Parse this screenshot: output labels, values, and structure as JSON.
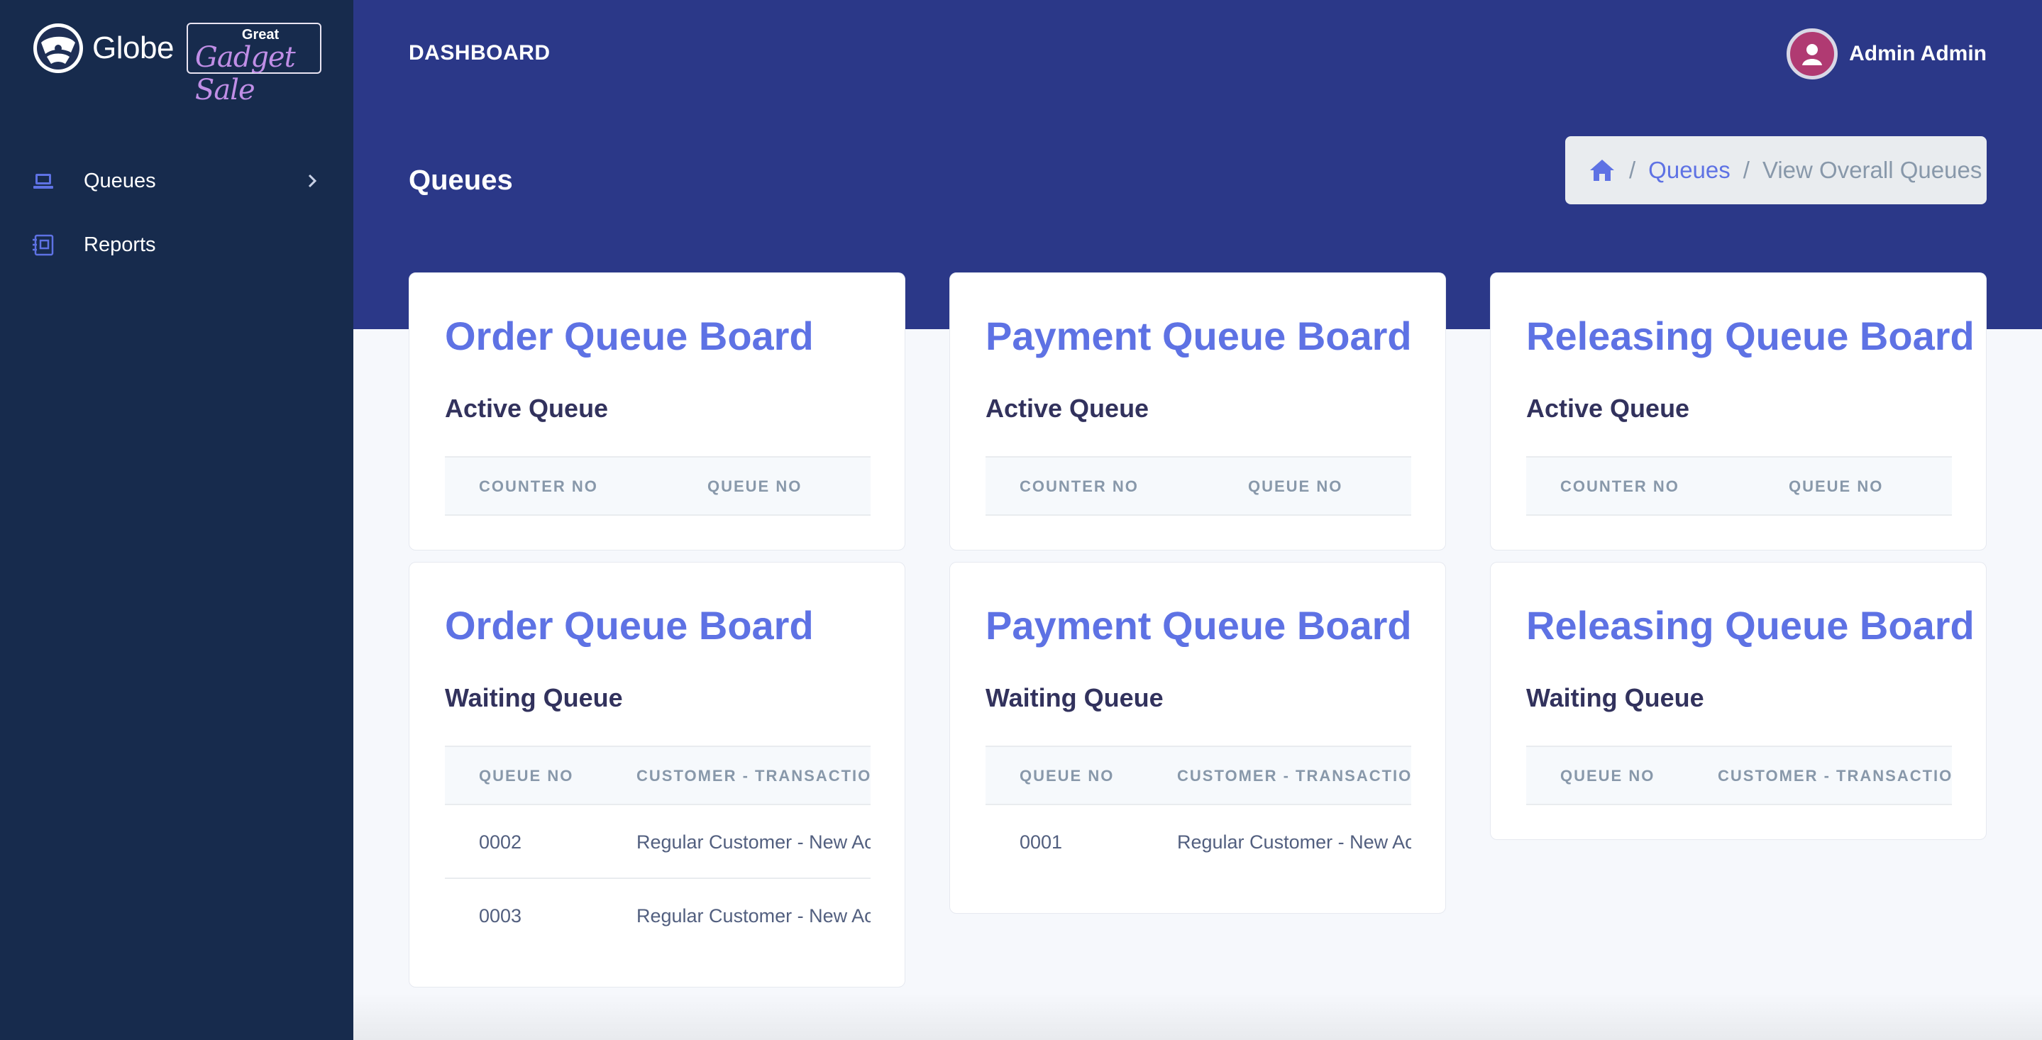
{
  "brand": {
    "name": "Globe",
    "sale_top": "Great",
    "sale_script": "Gadget Sale"
  },
  "sidebar": {
    "items": [
      {
        "label": "Queues",
        "icon": "laptop-icon",
        "has_chevron": true
      },
      {
        "label": "Reports",
        "icon": "reports-icon",
        "has_chevron": false
      }
    ]
  },
  "header": {
    "title": "DASHBOARD",
    "user_name": "Admin Admin"
  },
  "page": {
    "title": "Queues"
  },
  "breadcrumb": {
    "home_icon": "home-icon",
    "link": "Queues",
    "current": "View Overall Queues"
  },
  "boards": {
    "active": [
      {
        "title": "Order Queue Board",
        "subtitle": "Active Queue",
        "columns": [
          "COUNTER NO",
          "QUEUE NO"
        ],
        "rows": []
      },
      {
        "title": "Payment Queue Board",
        "subtitle": "Active Queue",
        "columns": [
          "COUNTER NO",
          "QUEUE NO"
        ],
        "rows": []
      },
      {
        "title": "Releasing Queue Board",
        "subtitle": "Active Queue",
        "columns": [
          "COUNTER NO",
          "QUEUE NO"
        ],
        "rows": []
      }
    ],
    "waiting": [
      {
        "title": "Order Queue Board",
        "subtitle": "Waiting Queue",
        "columns": [
          "QUEUE NO",
          "CUSTOMER - TRANSACTION"
        ],
        "rows": [
          {
            "queue_no": "0002",
            "transaction": "Regular Customer - New Acc"
          },
          {
            "queue_no": "0003",
            "transaction": "Regular Customer - New Acc"
          }
        ]
      },
      {
        "title": "Payment Queue Board",
        "subtitle": "Waiting Queue",
        "columns": [
          "QUEUE NO",
          "CUSTOMER - TRANSACTION"
        ],
        "rows": [
          {
            "queue_no": "0001",
            "transaction": "Regular Customer - New Acc"
          }
        ]
      },
      {
        "title": "Releasing Queue Board",
        "subtitle": "Waiting Queue",
        "columns": [
          "QUEUE NO",
          "CUSTOMER - TRANSACTION"
        ],
        "rows": []
      }
    ]
  },
  "colors": {
    "sidebar": "#172b4d",
    "header": "#2b3888",
    "accent": "#5e72e4",
    "avatar": "#b03a72"
  }
}
